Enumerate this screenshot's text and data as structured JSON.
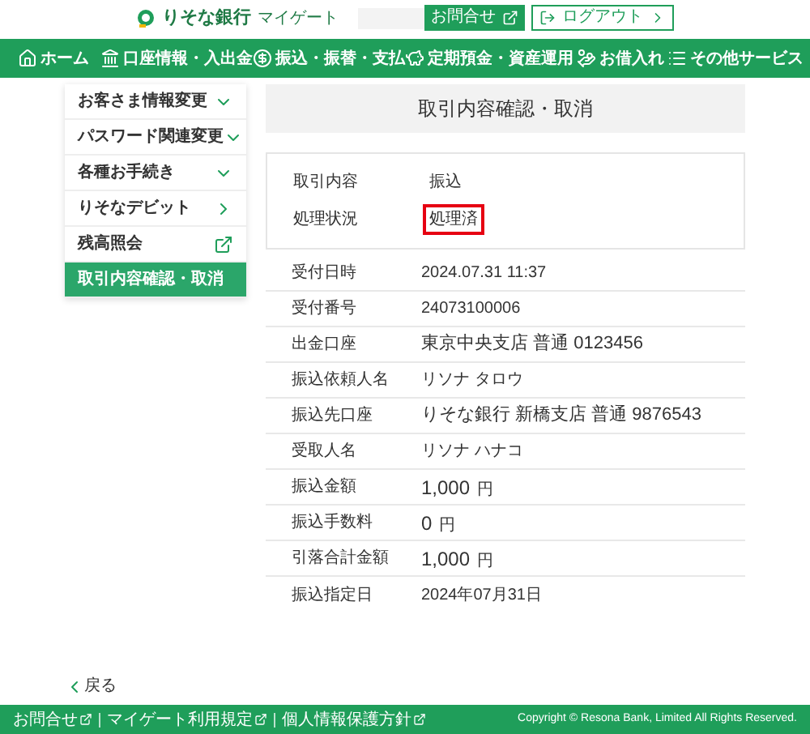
{
  "header": {
    "logo": "りそな銀行",
    "sublogo": "マイゲート",
    "buttons": [
      {
        "label": "お問合せ",
        "kind": "external"
      },
      {
        "label": "ログアウト",
        "kind": "logout"
      }
    ]
  },
  "nav": [
    {
      "label": "ホーム"
    },
    {
      "label": "口座情報・入出金"
    },
    {
      "label": "振込・振替・支払"
    },
    {
      "label": "定期預金・資産運用"
    },
    {
      "label": "お借入れ"
    },
    {
      "label": "その他サービス"
    }
  ],
  "sidebar": [
    {
      "label": "お客さま情報変更",
      "kind": "expand",
      "selected": false
    },
    {
      "label": "パスワード関連変更",
      "kind": "expand",
      "selected": false
    },
    {
      "label": "各種お手続き",
      "kind": "expand",
      "selected": false
    },
    {
      "label": "りそなデビット",
      "kind": "link",
      "selected": false
    },
    {
      "label": "残高照会",
      "kind": "external",
      "selected": false
    },
    {
      "label": "取引内容確認・取消",
      "kind": "link",
      "selected": true
    }
  ],
  "page_title": "取引内容確認・取消",
  "status": [
    {
      "label": "取引内容",
      "value": "振込",
      "highlighted": false
    },
    {
      "label": "処理状況",
      "value": "処理済",
      "highlighted": true
    }
  ],
  "details": [
    {
      "label": "受付日時",
      "value": "2024.07.31 11:37",
      "kind": "text"
    },
    {
      "label": "受付番号",
      "value": "24073100006",
      "kind": "text"
    },
    {
      "label": "出金口座",
      "value": "東京中央支店 普通 0123456",
      "kind": "large"
    },
    {
      "label": "振込依頼人名",
      "value": "リソナ タロウ",
      "kind": "text"
    },
    {
      "label": "振込先口座",
      "value": "りそな銀行 新橋支店 普通 9876543",
      "kind": "large"
    },
    {
      "label": "受取人名",
      "value": "リソナ ハナコ",
      "kind": "text"
    },
    {
      "label": "振込金額",
      "value": "1,000",
      "unit": "円",
      "kind": "amount"
    },
    {
      "label": "振込手数料",
      "value": "0",
      "unit": "円",
      "kind": "amount"
    },
    {
      "label": "引落合計金額",
      "value": "1,000",
      "unit": "円",
      "kind": "amount"
    },
    {
      "label": "振込指定日",
      "value": "2024年07月31日",
      "kind": "text"
    }
  ],
  "back_link": "戻る",
  "footer": {
    "links": [
      "お問合せ",
      "マイゲート利用規定",
      "個人情報保護方針"
    ],
    "copyright": "Copyright © Resona Bank, Limited All Rights Reserved."
  }
}
